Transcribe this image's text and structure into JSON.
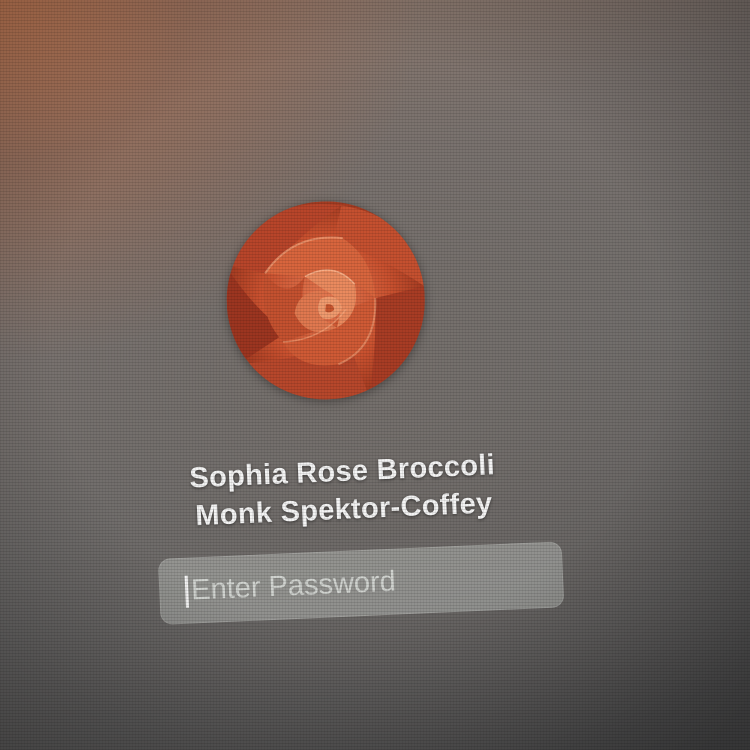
{
  "login": {
    "user": {
      "name_line1": "Sophia Rose Broccoli",
      "name_line2": "Monk Spektor-Coffey",
      "avatar_image": "rose-flower"
    },
    "password_field": {
      "placeholder": "Enter Password",
      "value": ""
    }
  },
  "colors": {
    "avatar_rose": "#c9512f",
    "text": "#f4f4f4",
    "field_background": "#c8cdc8"
  }
}
